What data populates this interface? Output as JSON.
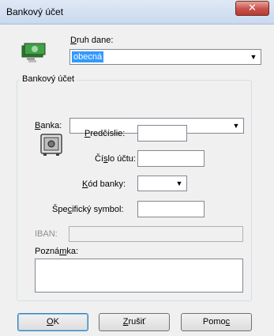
{
  "window": {
    "title": "Bankový účet",
    "close_glyph": "✕"
  },
  "druh_dane": {
    "label_first": "D",
    "label_rest": "ruh dane:",
    "value": "obecná",
    "icon": "money-notes-icon"
  },
  "group": {
    "title": "Bankový účet"
  },
  "banka": {
    "label_first": "B",
    "label_rest": "anka:",
    "value": ""
  },
  "safe_icon": "safe-icon",
  "predcislie": {
    "label_first": "P",
    "label_rest": "redčíslie:",
    "value": ""
  },
  "cislo_uctu": {
    "label_pre": "Čí",
    "label_u": "s",
    "label_post": "lo účtu:",
    "value": ""
  },
  "kod_banky": {
    "label_first": "K",
    "label_rest": "ód banky:",
    "value": ""
  },
  "specificky": {
    "label_pre": "Špe",
    "label_u": "c",
    "label_post": "ifický symbol:",
    "value": ""
  },
  "iban": {
    "label": "IBAN:",
    "value": ""
  },
  "poznamka": {
    "label_pre": "Pozná",
    "label_u": "m",
    "label_post": "ka:",
    "value": ""
  },
  "buttons": {
    "ok_u": "O",
    "ok_rest": "K",
    "cancel_u": "Z",
    "cancel_rest": "rušiť",
    "help_pre": "Pomo",
    "help_u": "c"
  },
  "dropdown_arrow": "▼"
}
